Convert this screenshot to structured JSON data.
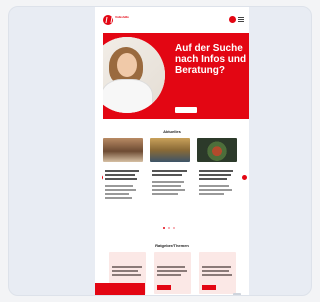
{
  "header": {
    "logo_text": "Volkshilfe",
    "user_icon": "user-icon",
    "menu_icon": "hamburger-menu-icon"
  },
  "hero": {
    "title": "Auf der Suche nach Infos und Beratung?",
    "subtitle": "",
    "button_label": ""
  },
  "news": {
    "section_title": "Aktuelles",
    "cards": [
      {
        "tag": "",
        "meta": ""
      },
      {
        "tag": "",
        "meta": ""
      },
      {
        "tag": "",
        "meta": ""
      }
    ]
  },
  "guides": {
    "section_title": "Ratgeber/Themen",
    "items": [
      {
        "heading": "",
        "button_label": ""
      },
      {
        "heading": "",
        "button_label": ""
      },
      {
        "heading": "",
        "button_label": ""
      }
    ]
  },
  "cookie": {
    "text": "",
    "button_label": ""
  },
  "colors": {
    "brand_red": "#e30613",
    "page_bg": "#ffffff",
    "outer_bg": "#e8ecf3"
  }
}
